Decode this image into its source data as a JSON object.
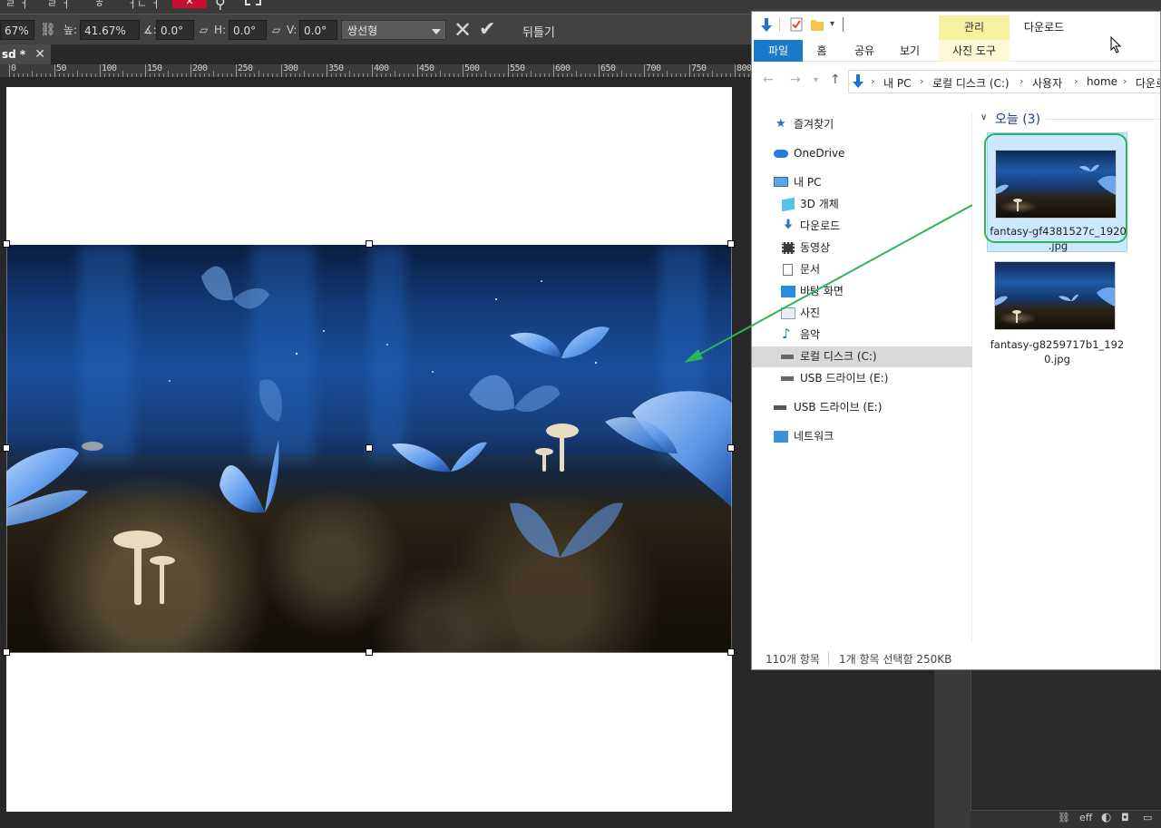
{
  "editor": {
    "top_menu_fragments": [
      "ㄹ ㅓ",
      "ㄹ ㅓ",
      "ㅎ",
      "ㅓㄴ ㅓ"
    ],
    "options_bar": {
      "zoom_w": "67%",
      "height_label": "높:",
      "height_value": "41.67%",
      "angle_label": "∡:",
      "angle_value": "0.0°",
      "h_label": "H:",
      "h_value": "0.0°",
      "v_label": "V:",
      "v_value": "0.0°",
      "interpolation": "쌍선형",
      "flip_label": "뒤틀기"
    },
    "tab": {
      "label": "sd *"
    },
    "ruler_labels": [
      "0",
      "50",
      "100",
      "150",
      "200",
      "250",
      "300",
      "350",
      "400",
      "450",
      "500",
      "550",
      "600",
      "650",
      "700",
      "750",
      "800"
    ],
    "bottom_right_icons": [
      "link-icon",
      "eff",
      "contrast-icon",
      "camera-icon"
    ],
    "bottom_right_text": "eff"
  },
  "explorer": {
    "title": "다운로드",
    "context_tab_group": "관리",
    "ribbon_tabs": [
      "파일",
      "홈",
      "공유",
      "보기",
      "사진 도구"
    ],
    "address_parts": [
      "내 PC",
      "로컬 디스크 (C:)",
      "사용자",
      "home",
      "다운로"
    ],
    "nav": [
      {
        "label": "즐겨찾기",
        "icon": "star-icon",
        "indent": 0
      },
      {
        "label": "OneDrive",
        "icon": "cloud-icon",
        "indent": 0
      },
      {
        "label": "내 PC",
        "icon": "pc-icon",
        "indent": 0
      },
      {
        "label": "3D 개체",
        "icon": "cube-icon",
        "indent": 1
      },
      {
        "label": "다운로드",
        "icon": "download-icon",
        "indent": 1
      },
      {
        "label": "동영상",
        "icon": "film-icon",
        "indent": 1
      },
      {
        "label": "문서",
        "icon": "document-icon",
        "indent": 1
      },
      {
        "label": "바탕 화면",
        "icon": "desktop-icon",
        "indent": 1
      },
      {
        "label": "사진",
        "icon": "pictures-icon",
        "indent": 1
      },
      {
        "label": "음악",
        "icon": "music-icon",
        "indent": 1
      },
      {
        "label": "로컬 디스크 (C:)",
        "icon": "drive-icon",
        "indent": 1,
        "selected": true
      },
      {
        "label": "USB 드라이브 (E:)",
        "icon": "usb-icon",
        "indent": 1
      },
      {
        "label": "USB 드라이브 (E:)",
        "icon": "usb-icon",
        "indent": 0
      },
      {
        "label": "네트워크",
        "icon": "network-icon",
        "indent": 0
      }
    ],
    "group_header": "오늘 (3)",
    "files": [
      {
        "name_line1": "fantasy-gf4381527c_1920",
        "name_line2": ".jpg",
        "selected": true
      },
      {
        "name_line1": "fantasy-g8259717b1_192",
        "name_line2": "0.jpg",
        "selected": false
      }
    ],
    "status": {
      "item_count": "110개 항목",
      "selection": "1개 항목 선택함 250KB"
    }
  },
  "colors": {
    "accent_blue": "#1979ca",
    "manage_yellow": "#f7f0a0",
    "annotation_green": "#2db35a",
    "editor_cancel_red": "#c8102e"
  }
}
